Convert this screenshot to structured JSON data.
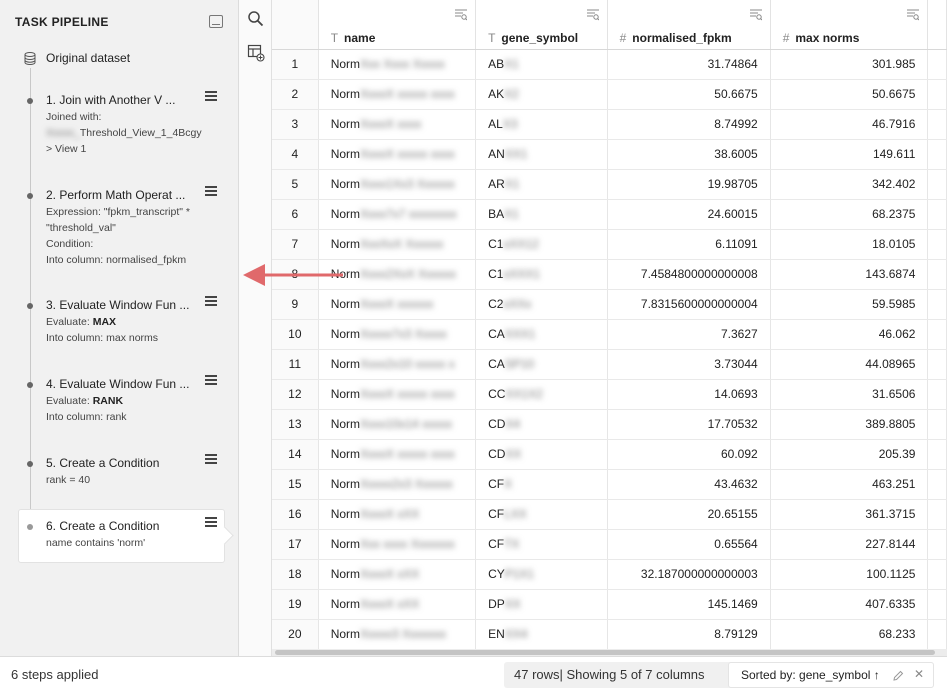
{
  "pipeline": {
    "header": "TASK PIPELINE",
    "dataset_label": "Original dataset",
    "steps": [
      {
        "title": "1. Join with Another V ...",
        "lines": [
          "Joined with:",
          "Threshold_View_1_4Bcgy",
          "> View 1"
        ],
        "blurred_prefix": "Xxxxx_"
      },
      {
        "title": "2. Perform Math Operat ...",
        "lines": [
          "Expression: \"fpkm_transcript\" *",
          "\"threshold_val\"",
          "Condition:",
          "Into column: normalised_fpkm"
        ]
      },
      {
        "title": "3. Evaluate Window Fun ...",
        "line1_prefix": "Evaluate: ",
        "line1_bold": "MAX",
        "line2": "Into column: max norms"
      },
      {
        "title": "4. Evaluate Window Fun ...",
        "line1_prefix": "Evaluate: ",
        "line1_bold": "RANK",
        "line2": "Into column: rank"
      },
      {
        "title": "5. Create a Condition",
        "line1": "rank = 40"
      },
      {
        "title": "6. Create a Condition",
        "line1": "name contains 'norm'"
      }
    ]
  },
  "table": {
    "columns": [
      {
        "name": "",
        "type": ""
      },
      {
        "name": "name",
        "type": "T"
      },
      {
        "name": "gene_symbol",
        "type": "T"
      },
      {
        "name": "normalised_fpkm",
        "type": "#"
      },
      {
        "name": "max norms",
        "type": "#"
      }
    ],
    "rows": [
      {
        "idx": "1",
        "name": "Norm",
        "name_blur": "Xxx Xxxx Xxxxx",
        "gene": "AB",
        "gene_blur": "X1",
        "fpkm": "31.74864",
        "max": "301.985"
      },
      {
        "idx": "2",
        "name": "Norm",
        "name_blur": "XxxxX xxxxx xxxx",
        "gene": "AK",
        "gene_blur": "X2",
        "fpkm": "50.6675",
        "max": "50.6675"
      },
      {
        "idx": "3",
        "name": "Norm",
        "name_blur": "XxxxX xxxx",
        "gene": "AL",
        "gene_blur": "X3",
        "fpkm": "8.74992",
        "max": "46.7916"
      },
      {
        "idx": "4",
        "name": "Norm",
        "name_blur": "XxxxX xxxxx xxxx",
        "gene": "AN",
        "gene_blur": "XX1",
        "fpkm": "38.6005",
        "max": "149.611"
      },
      {
        "idx": "5",
        "name": "Norm",
        "name_blur": "Xxxx1Xx3 Xxxxxx",
        "gene": "AR",
        "gene_blur": "X1",
        "fpkm": "19.98705",
        "max": "342.402"
      },
      {
        "idx": "6",
        "name": "Norm",
        "name_blur": "Xxxx7x7 xxxxxxxx",
        "gene": "BA",
        "gene_blur": "X1",
        "fpkm": "24.60015",
        "max": "68.2375"
      },
      {
        "idx": "7",
        "name": "Norm",
        "name_blur": "XxxXxX Xxxxxx",
        "gene": "C1",
        "gene_blur": "xXX12",
        "fpkm": "6.11091",
        "max": "18.0105"
      },
      {
        "idx": "8",
        "name": "Norm",
        "name_blur": "Xxxx2XxX Xxxxxx",
        "gene": "C1",
        "gene_blur": "xXXX1",
        "fpkm": "7.4584800000000008",
        "max": "143.6874"
      },
      {
        "idx": "9",
        "name": "Norm",
        "name_blur": "XxxxX xxxxxx",
        "gene": "C2",
        "gene_blur": "xXXx",
        "fpkm": "7.8315600000000004",
        "max": "59.5985"
      },
      {
        "idx": "10",
        "name": "Norm",
        "name_blur": "Xxxxx7x3 Xxxxx",
        "gene": "CA",
        "gene_blur": "XXX1",
        "fpkm": "7.3627",
        "max": "46.062"
      },
      {
        "idx": "11",
        "name": "Norm",
        "name_blur": "Xxxx2x10 xxxxx x",
        "gene": "CA",
        "gene_blur": "SP10",
        "fpkm": "3.73044",
        "max": "44.08965"
      },
      {
        "idx": "12",
        "name": "Norm",
        "name_blur": "XxxxX xxxxx xxxx",
        "gene": "CC",
        "gene_blur": "XX1X2",
        "fpkm": "14.0693",
        "max": "31.6506"
      },
      {
        "idx": "13",
        "name": "Norm",
        "name_blur": "Xxxx10x14 xxxxx",
        "gene": "CD",
        "gene_blur": "X4",
        "fpkm": "17.70532",
        "max": "389.8805"
      },
      {
        "idx": "14",
        "name": "Norm",
        "name_blur": "XxxxX xxxxx xxxx",
        "gene": "CD",
        "gene_blur": "XX",
        "fpkm": "60.092",
        "max": "205.39"
      },
      {
        "idx": "15",
        "name": "Norm",
        "name_blur": "Xxxxx2x3 Xxxxxx",
        "gene": "CF",
        "gene_blur": "X",
        "fpkm": "43.4632",
        "max": "463.251"
      },
      {
        "idx": "16",
        "name": "Norm",
        "name_blur": "XxxxX xXX",
        "gene": "CF",
        "gene_blur": "LXX",
        "fpkm": "20.65155",
        "max": "361.3715"
      },
      {
        "idx": "17",
        "name": "Norm",
        "name_blur": "Xxx xxxx Xxxxxxx",
        "gene": "CF",
        "gene_blur": "TX",
        "fpkm": "0.65564",
        "max": "227.8144"
      },
      {
        "idx": "18",
        "name": "Norm",
        "name_blur": "XxxxX xXX",
        "gene": "CY",
        "gene_blur": "P1X1",
        "fpkm": "32.187000000000003",
        "max": "100.1125"
      },
      {
        "idx": "19",
        "name": "Norm",
        "name_blur": "XxxxX xXX",
        "gene": "DP",
        "gene_blur": "XX",
        "fpkm": "145.1469",
        "max": "407.6335"
      },
      {
        "idx": "20",
        "name": "Norm",
        "name_blur": "Xxxxx3 Xxxxxxx",
        "gene": "EN",
        "gene_blur": "XX4",
        "fpkm": "8.79129",
        "max": "68.233"
      }
    ]
  },
  "footer": {
    "steps_applied": "6 steps applied",
    "rows_info": "47 rows| Showing 5 of 7 columns",
    "sorted_label": "Sorted by: gene_symbol ↑"
  },
  "colors": {
    "arrow": "#e0696b",
    "panel_bg": "#f1f1f1",
    "footer_pill": "#f0f0f0"
  },
  "icons": [
    "database-icon",
    "collapse-panel-icon",
    "hamburger-menu-icon",
    "search-icon",
    "add-table-icon",
    "column-filter-icon",
    "pencil-icon",
    "close-icon"
  ]
}
